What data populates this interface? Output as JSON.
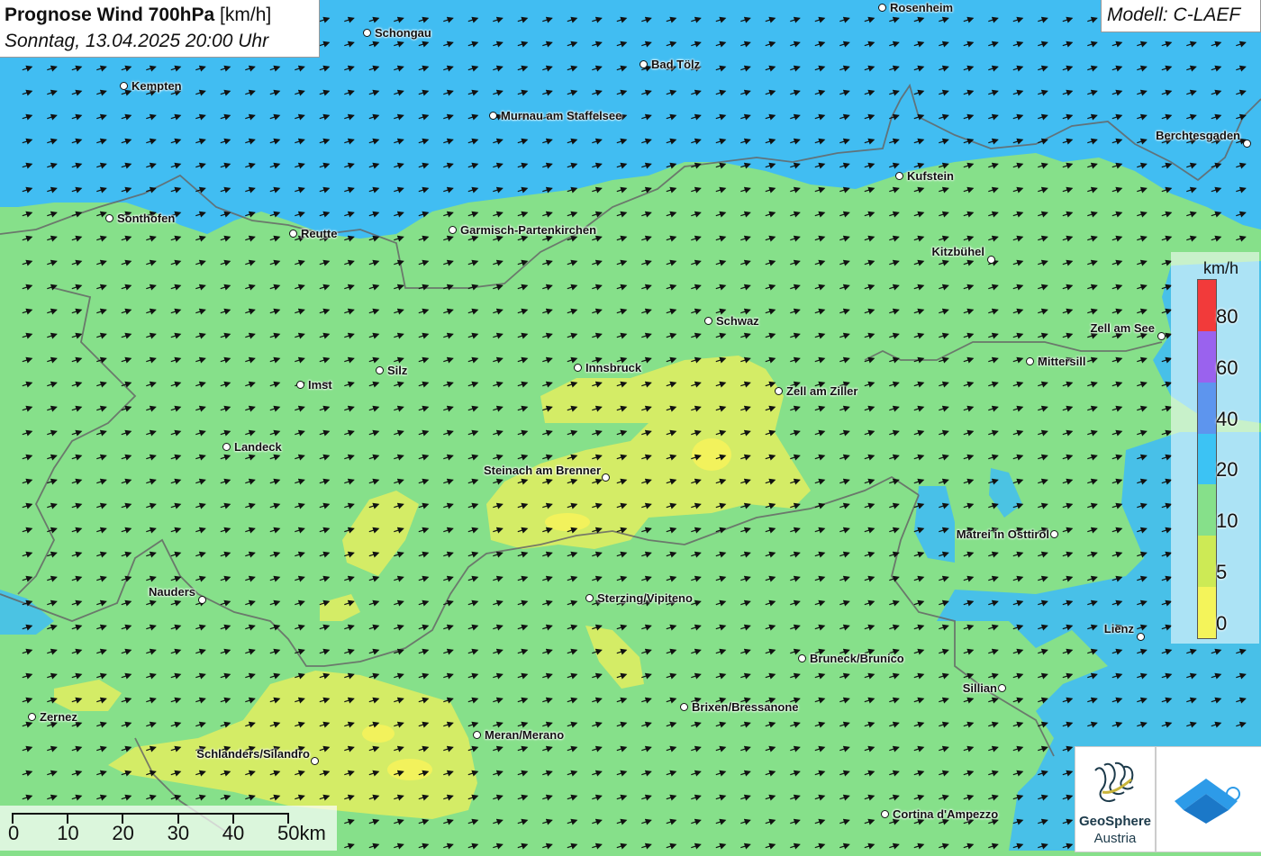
{
  "header": {
    "title_bold": "Prognose Wind 700hPa",
    "title_unit": " [km/h]",
    "subtitle": "Sonntag, 13.04.2025 20:00 Uhr",
    "model": "Modell: C-LAEF"
  },
  "cities": [
    {
      "name": "Rosenheim",
      "label": "Rosenheim"
    },
    {
      "name": "Schongau",
      "label": "Schongau"
    },
    {
      "name": "Bad Tölz",
      "label": "Bad Tölz"
    },
    {
      "name": "Kempten",
      "label": "Kempten"
    },
    {
      "name": "Murnau",
      "label": "Murnau am Staffelsee"
    },
    {
      "name": "Berchtesgaden",
      "label": "Berchtesgaden"
    },
    {
      "name": "Kufstein",
      "label": "Kufstein"
    },
    {
      "name": "Sonthofen",
      "label": "Sonthofen"
    },
    {
      "name": "Reutte",
      "label": "Reutte"
    },
    {
      "name": "Garmisch",
      "label": "Garmisch-Partenkirchen"
    },
    {
      "name": "Kitzbühel",
      "label": "Kitzbühel"
    },
    {
      "name": "Schwaz",
      "label": "Schwaz"
    },
    {
      "name": "Zell am See",
      "label": "Zell am See"
    },
    {
      "name": "Mittersill",
      "label": "Mittersill"
    },
    {
      "name": "Silz",
      "label": "Silz"
    },
    {
      "name": "Innsbruck",
      "label": "Innsbruck"
    },
    {
      "name": "Imst",
      "label": "Imst"
    },
    {
      "name": "Zell am Ziller",
      "label": "Zell am Ziller"
    },
    {
      "name": "Landeck",
      "label": "Landeck"
    },
    {
      "name": "Steinach",
      "label": "Steinach am Brenner"
    },
    {
      "name": "Matrei",
      "label": "Matrei in Osttirol"
    },
    {
      "name": "Nauders",
      "label": "Nauders"
    },
    {
      "name": "Sterzing",
      "label": "Sterzing/Vipiteno"
    },
    {
      "name": "Lienz",
      "label": "Lienz"
    },
    {
      "name": "Bruneck",
      "label": "Bruneck/Brunico"
    },
    {
      "name": "Sillian",
      "label": "Sillian"
    },
    {
      "name": "Brixen",
      "label": "Brixen/Bressanone"
    },
    {
      "name": "Zernez",
      "label": "Zernez"
    },
    {
      "name": "Meran",
      "label": "Meran/Merano"
    },
    {
      "name": "Schlanders",
      "label": "Schlanders/Silandro"
    },
    {
      "name": "Cortina",
      "label": "Cortina d'Ampezzo"
    }
  ],
  "legend": {
    "unit": "km/h",
    "classes": [
      {
        "label": "80",
        "color": "#f23a3a"
      },
      {
        "label": "60",
        "color": "#9a62ee"
      },
      {
        "label": "40",
        "color": "#5d95ee"
      },
      {
        "label": "20",
        "color": "#3cc3f4"
      },
      {
        "label": "10",
        "color": "#86e08a"
      },
      {
        "label": "5",
        "color": "#cdea55"
      },
      {
        "label": "0",
        "color": "#f4f45a"
      }
    ]
  },
  "scalebar": {
    "labels": [
      "0",
      "10",
      "20",
      "30",
      "40",
      "50km"
    ]
  },
  "logos": {
    "geosphere_name": "GeoSphere",
    "geosphere_sub": "Austria"
  },
  "colors": {
    "water_fast": "#41bdf2",
    "medium": "#86e08a",
    "slow": "#d9ee6a"
  },
  "wind": {
    "direction": "from west-southwest (towards east-northeast)"
  }
}
